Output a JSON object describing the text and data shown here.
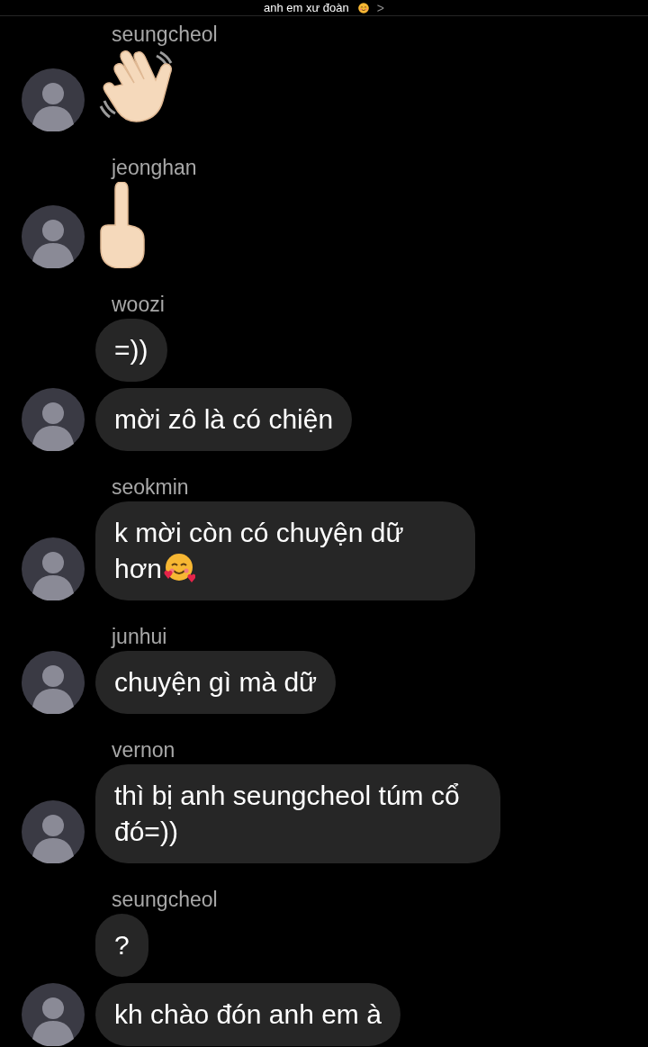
{
  "header": {
    "title": "anh em xư đoàn",
    "chevron": ">"
  },
  "groups": [
    {
      "sender": "seungcheol",
      "messages": [
        {
          "kind": "wave_emoji"
        }
      ]
    },
    {
      "sender": "jeonghan",
      "messages": [
        {
          "kind": "finger_emoji"
        }
      ]
    },
    {
      "sender": "woozi",
      "messages": [
        {
          "kind": "text",
          "text": "=))"
        },
        {
          "kind": "text",
          "text": "mời zô là có chiện"
        }
      ]
    },
    {
      "sender": "seokmin",
      "messages": [
        {
          "kind": "text_with_emoji",
          "text": "k mời còn có chuyện dữ hơn"
        }
      ]
    },
    {
      "sender": "junhui",
      "messages": [
        {
          "kind": "text",
          "text": "chuyện gì mà dữ"
        }
      ]
    },
    {
      "sender": "vernon",
      "messages": [
        {
          "kind": "text",
          "text": "thì bị anh seungcheol túm cổ đó=))"
        }
      ]
    },
    {
      "sender": "seungcheol",
      "messages": [
        {
          "kind": "text",
          "text": "?"
        },
        {
          "kind": "text",
          "text": "kh chào đón anh em à"
        }
      ]
    }
  ]
}
